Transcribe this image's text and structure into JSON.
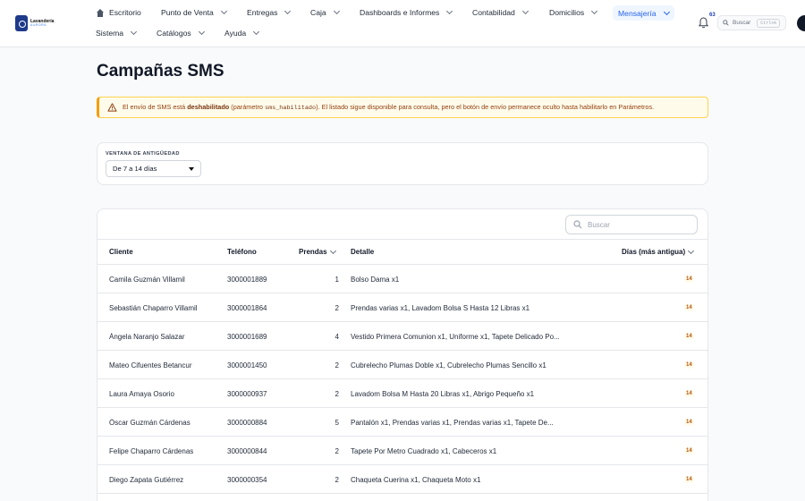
{
  "brand": {
    "line1": "Lavandería",
    "line2": "AURORA"
  },
  "nav": {
    "row1": [
      {
        "label": "Escritorio",
        "icon": "home-icon"
      },
      {
        "label": "Punto de Venta"
      },
      {
        "label": "Entregas"
      },
      {
        "label": "Caja"
      },
      {
        "label": "Dashboards e Informes"
      },
      {
        "label": "Contabilidad"
      },
      {
        "label": "Domicilios"
      },
      {
        "label": "Mensajería",
        "active": true
      }
    ],
    "row2": [
      {
        "label": "Sistema"
      },
      {
        "label": "Catálogos"
      },
      {
        "label": "Ayuda"
      }
    ]
  },
  "notifications": {
    "count": "63",
    "icon": "bell-icon"
  },
  "top_search": {
    "placeholder": "Buscar",
    "shortcut": "Ctrl+K"
  },
  "page": {
    "title": "Campañas SMS"
  },
  "alert": {
    "prefix": "El envío de SMS está ",
    "bold": "deshabilitado",
    "mid": " (parámetro ",
    "code": "sms_habilitado",
    "suffix": "). El listado sigue disponible para consulta, pero el botón de envío permanece oculto hasta habilitarlo en Parámetros.",
    "accent": "#f59e0b"
  },
  "filter": {
    "label": "VENTANA DE ANTIGÜEDAD",
    "value": "De 7 a 14 días"
  },
  "table": {
    "search_placeholder": "Buscar",
    "headers": {
      "cliente": "Cliente",
      "telefono": "Teléfono",
      "prendas": "Prendas",
      "detalle": "Detalle",
      "dias": "Días (más antigua)"
    },
    "rows": [
      {
        "cliente": "Camila Guzmán Villamil",
        "telefono": "3000001889",
        "prendas": "1",
        "detalle": "Bolso Dama x1",
        "dias": "14"
      },
      {
        "cliente": "Sebastián Chaparro Villamil",
        "telefono": "3000001864",
        "prendas": "2",
        "detalle": "Prendas varias x1, Lavadom Bolsa S Hasta 12 Libras x1",
        "dias": "14"
      },
      {
        "cliente": "Ángela Naranjo Salazar",
        "telefono": "3000001689",
        "prendas": "4",
        "detalle": "Vestido Primera Comunion x1, Uniforme x1, Tapete Delicado Po...",
        "dias": "14"
      },
      {
        "cliente": "Mateo Cifuentes Betancur",
        "telefono": "3000001450",
        "prendas": "2",
        "detalle": "Cubrelecho Plumas Doble x1, Cubrelecho Plumas Sencillo x1",
        "dias": "14"
      },
      {
        "cliente": "Laura Amaya Osorio",
        "telefono": "3000000937",
        "prendas": "2",
        "detalle": "Lavadom Bolsa M Hasta 20 Libras x1, Abrigo Pequeño x1",
        "dias": "14"
      },
      {
        "cliente": "Óscar Guzmán Cárdenas",
        "telefono": "3000000884",
        "prendas": "5",
        "detalle": "Pantalón x1, Prendas varias x1, Prendas varias x1, Tapete De...",
        "dias": "14"
      },
      {
        "cliente": "Felipe Chaparro Cárdenas",
        "telefono": "3000000844",
        "prendas": "2",
        "detalle": "Tapete Por Metro Cuadrado x1, Cabeceros x1",
        "dias": "14"
      },
      {
        "cliente": "Diego Zapata Gutiérrez",
        "telefono": "3000000354",
        "prendas": "2",
        "detalle": "Chaqueta Cuerina x1, Chaqueta Moto x1",
        "dias": "14"
      }
    ]
  }
}
